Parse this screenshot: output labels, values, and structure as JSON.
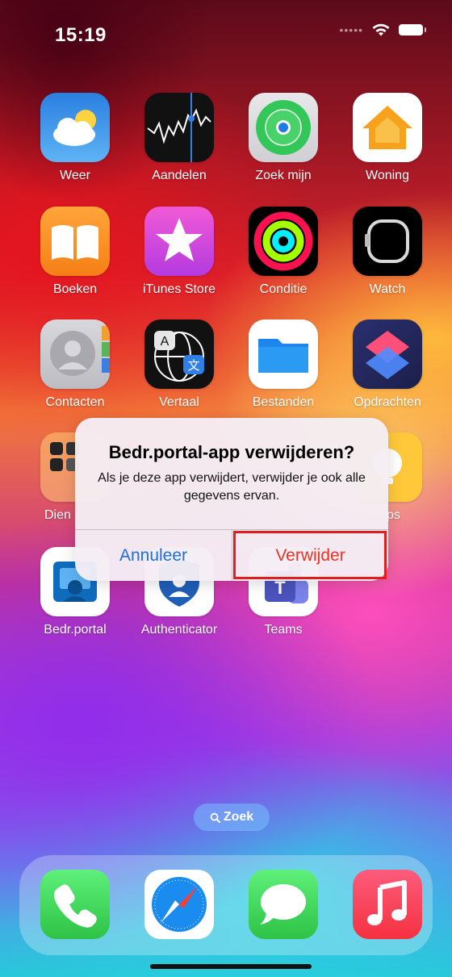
{
  "status_bar": {
    "time": "15:19"
  },
  "apps": [
    {
      "label": "Weer",
      "icon": "weather-icon"
    },
    {
      "label": "Aandelen",
      "icon": "stocks-icon"
    },
    {
      "label": "Zoek mijn",
      "icon": "findmy-icon"
    },
    {
      "label": "Woning",
      "icon": "home-icon"
    },
    {
      "label": "Boeken",
      "icon": "books-icon"
    },
    {
      "label": "iTunes Store",
      "icon": "itunes-star-icon"
    },
    {
      "label": "Conditie",
      "icon": "fitness-rings-icon"
    },
    {
      "label": "Watch",
      "icon": "watch-icon"
    },
    {
      "label": "Contacten",
      "icon": "contacts-icon"
    },
    {
      "label": "Vertaal",
      "icon": "translate-icon"
    },
    {
      "label": "Bestanden",
      "icon": "files-folder-icon"
    },
    {
      "label": "Opdrachten",
      "icon": "shortcuts-icon"
    },
    {
      "label": "Dien",
      "icon": "utilities-folder-icon"
    },
    {
      "label": "ps",
      "icon": "tips-icon"
    },
    {
      "label": "Bedr.portal",
      "icon": "company-portal-icon"
    },
    {
      "label": "Authenticator",
      "icon": "authenticator-icon"
    },
    {
      "label": "Teams",
      "icon": "teams-icon"
    }
  ],
  "search": {
    "label": "Zoek",
    "icon": "search-icon"
  },
  "dock": [
    {
      "name": "Telefoon",
      "icon": "phone-icon"
    },
    {
      "name": "Safari",
      "icon": "safari-compass-icon"
    },
    {
      "name": "Berichten",
      "icon": "messages-icon"
    },
    {
      "name": "Muziek",
      "icon": "music-icon"
    }
  ],
  "alert": {
    "title": "Bedr.portal-app verwijderen?",
    "message": "Als je deze app verwijdert, verwijder je ook alle gegevens ervan.",
    "cancel_label": "Annuleer",
    "delete_label": "Verwijder"
  },
  "colors": {
    "accent_blue": "#1d6fdc",
    "destructive_red": "#ea3323",
    "highlight_red": "#e01e1e"
  }
}
